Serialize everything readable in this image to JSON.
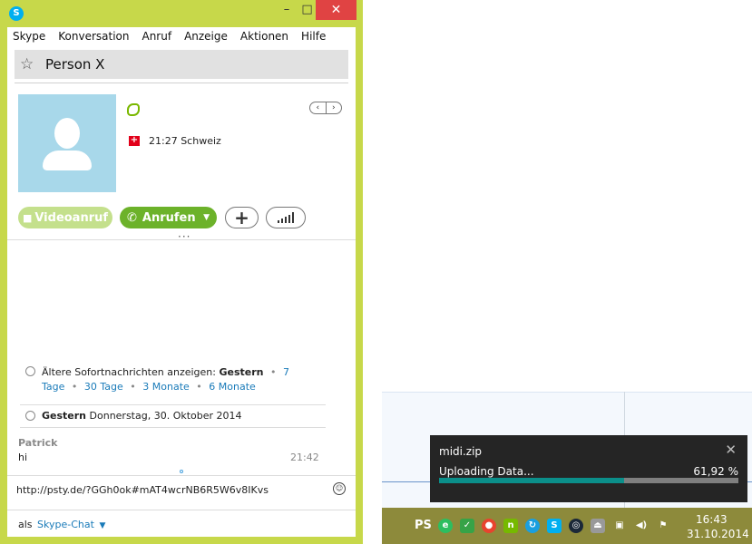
{
  "skype": {
    "menu": [
      "Skype",
      "Konversation",
      "Anruf",
      "Anzeige",
      "Aktionen",
      "Hilfe"
    ],
    "window_controls": {
      "minimize": "–",
      "maximize": "□",
      "close": "✕"
    },
    "contact": {
      "name": "Person X",
      "local_time": "21:27 Schweiz",
      "flag": "switzerland-flag"
    },
    "buttons": {
      "video_call": "Videoanruf",
      "call": "Anrufen",
      "add": "+"
    },
    "history": {
      "prefix": "Ältere Sofortnachrichten anzeigen:",
      "options": [
        "Gestern",
        "7 Tage",
        "30 Tage",
        "3 Monate",
        "6 Monate"
      ]
    },
    "date_header": {
      "bold": "Gestern",
      "rest": "Donnerstag, 30. Oktober 2014"
    },
    "message": {
      "sender": "Patrick",
      "text": "hi",
      "time": "21:42"
    },
    "input": {
      "value": "http://psty.de/?GGh0ok#mAT4wcrNB6R5W6v8IKvs"
    },
    "chat_mode": {
      "prefix": "als",
      "mode": "Skype-Chat"
    }
  },
  "toast": {
    "filename": "midi.zip",
    "status": "Uploading Data...",
    "percent_label": "61,92 %",
    "progress_fraction": 0.6192
  },
  "taskbar": {
    "ps_label": "PS",
    "time": "16:43",
    "date": "31.10.2014"
  },
  "colors": {
    "skype_frame": "#c7d84a",
    "call_green": "#6cb22a",
    "link_blue": "#1a7bb9",
    "progress": "#0b8f8a",
    "taskbar": "#8d8a3b"
  }
}
